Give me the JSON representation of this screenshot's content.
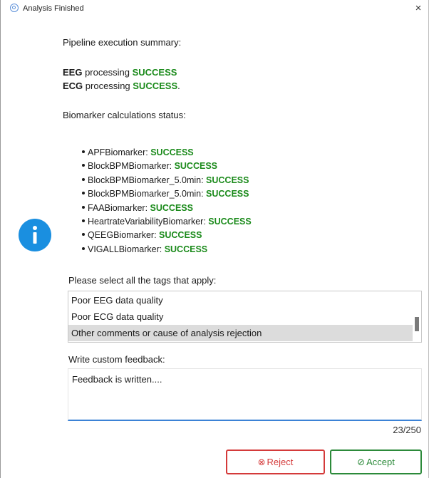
{
  "window": {
    "title": "Analysis Finished",
    "close_glyph": "×",
    "icon": "app-icon"
  },
  "summary": {
    "title": "Pipeline execution summary:",
    "lines": [
      {
        "label": "EEG",
        "middle": " processing ",
        "status": "SUCCESS",
        "suffix": ""
      },
      {
        "label": "ECG",
        "middle": " processing ",
        "status": "SUCCESS",
        "suffix": "."
      }
    ]
  },
  "biomarkers": {
    "title": "Biomarker calculations status:",
    "items": [
      {
        "name": "APFBiomarker: ",
        "status": "SUCCESS"
      },
      {
        "name": "BlockBPMBiomarker: ",
        "status": "SUCCESS"
      },
      {
        "name": "BlockBPMBiomarker_5.0min: ",
        "status": "SUCCESS"
      },
      {
        "name": "BlockBPMBiomarker_5.0min: ",
        "status": "SUCCESS"
      },
      {
        "name": "FAABiomarker: ",
        "status": "SUCCESS"
      },
      {
        "name": "HeartrateVariabilityBiomarker: ",
        "status": "SUCCESS"
      },
      {
        "name": "QEEGBiomarker: ",
        "status": "SUCCESS"
      },
      {
        "name": "VIGALLBiomarker: ",
        "status": "SUCCESS"
      }
    ]
  },
  "tags": {
    "label": "Please select all the tags that apply:",
    "options": [
      {
        "label": "Poor EEG data quality",
        "selected": false
      },
      {
        "label": "Poor ECG data quality",
        "selected": false
      },
      {
        "label": "Other comments or cause of analysis rejection",
        "selected": true
      }
    ]
  },
  "feedback": {
    "label": "Write custom feedback:",
    "value": "Feedback is written....",
    "count": "23/250"
  },
  "buttons": {
    "reject_glyph": "⊗",
    "reject_label": "Reject",
    "accept_glyph": "⊘",
    "accept_label": "Accept"
  },
  "colors": {
    "success": "#1a8a1a",
    "reject": "#d43a3a",
    "accept": "#2c8a3a",
    "info_icon": "#1a8fe0",
    "focus_underline": "#3b82d6"
  }
}
